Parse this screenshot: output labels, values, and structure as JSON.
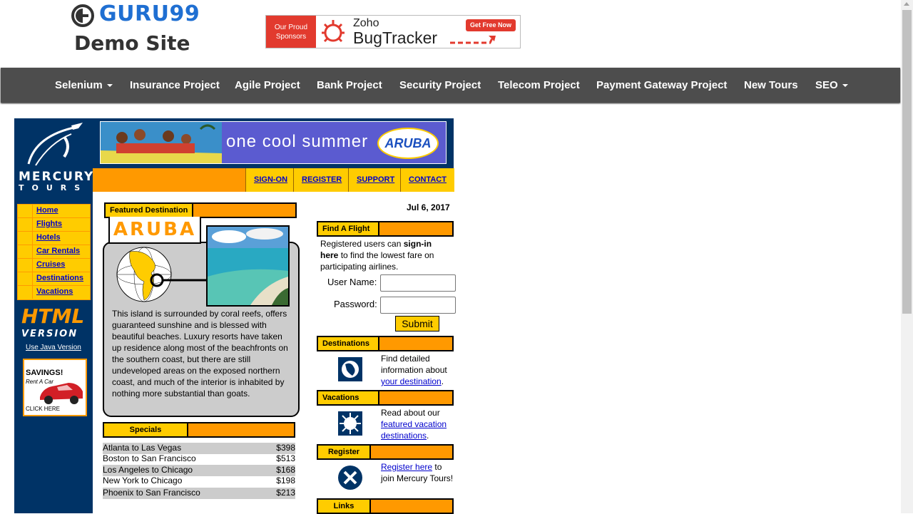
{
  "header": {
    "logo_text": "GURU99",
    "logo_sub": "Demo Site",
    "sponsor": {
      "left_line1": "Our Proud",
      "left_line2": "Sponsors",
      "brand": "Zoho",
      "product": "BugTracker",
      "cta": "Get Free Now"
    }
  },
  "nav": {
    "items": [
      {
        "label": "Selenium",
        "dropdown": true
      },
      {
        "label": "Insurance Project"
      },
      {
        "label": "Agile Project"
      },
      {
        "label": "Bank Project"
      },
      {
        "label": "Security Project"
      },
      {
        "label": "Telecom Project"
      },
      {
        "label": "Payment Gateway Project"
      },
      {
        "label": "New Tours"
      },
      {
        "label": "SEO",
        "dropdown": true
      }
    ]
  },
  "mercury": {
    "logo_line1": "MERCURY",
    "logo_line2": "TOURS",
    "side_menu": [
      "Home",
      "Flights",
      "Hotels",
      "Car Rentals",
      "Cruises",
      "Destinations",
      "Vacations"
    ],
    "html_version_line1": "HTML",
    "html_version_line2": "VERSION",
    "java_link": "Use Java Version",
    "ad": {
      "title": "SAVINGS!",
      "sub": "Rent A Car",
      "cta": "CLICK HERE"
    }
  },
  "banner": {
    "text": "one cool summer",
    "brand": "ARUBA"
  },
  "top_links": [
    "SIGN-ON",
    "REGISTER",
    "SUPPORT",
    "CONTACT"
  ],
  "featured": {
    "header": "Featured Destination",
    "name": "ARUBA",
    "description": "This island is surrounded by coral reefs, offers guaranteed sunshine and is blessed with beautiful beaches. Luxury resorts have taken up residence along most of the beachfronts on the southern coast, but there are still undeveloped areas on the exposed northern coast, and much of the interior is inhabited by nothing more substantial than goats."
  },
  "specials": {
    "header": "Specials",
    "rows": [
      {
        "route": "Atlanta to Las Vegas",
        "price": "$398"
      },
      {
        "route": "Boston to San Francisco",
        "price": "$513"
      },
      {
        "route": "Los Angeles to Chicago",
        "price": "$168"
      },
      {
        "route": "New York to Chicago",
        "price": "$198"
      },
      {
        "route": "Phoenix to San Francisco",
        "price": "$213"
      }
    ]
  },
  "right": {
    "date": "Jul 6, 2017",
    "find_flight": {
      "header": "Find A Flight",
      "text_pre": "Registered users can ",
      "text_bold": "sign-in here",
      "text_post": " to find the lowest fare on participating airlines.",
      "username_label": "User Name:",
      "password_label": "Password:",
      "username_value": "",
      "password_value": "",
      "submit": "Submit"
    },
    "destinations": {
      "header": "Destinations",
      "text_pre": "Find detailed information about ",
      "link": "your destination",
      "text_post": "."
    },
    "vacations": {
      "header": "Vacations",
      "text_pre": "Read about our ",
      "link": "featured vacation destinations",
      "text_post": "."
    },
    "register": {
      "header": "Register",
      "link": "Register here",
      "text_post": " to join Mercury Tours!"
    },
    "links": {
      "header": "Links"
    }
  },
  "colors": {
    "navy": "#003366",
    "orange": "#ff9900",
    "yellow": "#ffcc00",
    "nav_bg": "#4d4d4d",
    "guru_blue": "#1f6fd2",
    "zoho_red": "#e23a2e"
  }
}
